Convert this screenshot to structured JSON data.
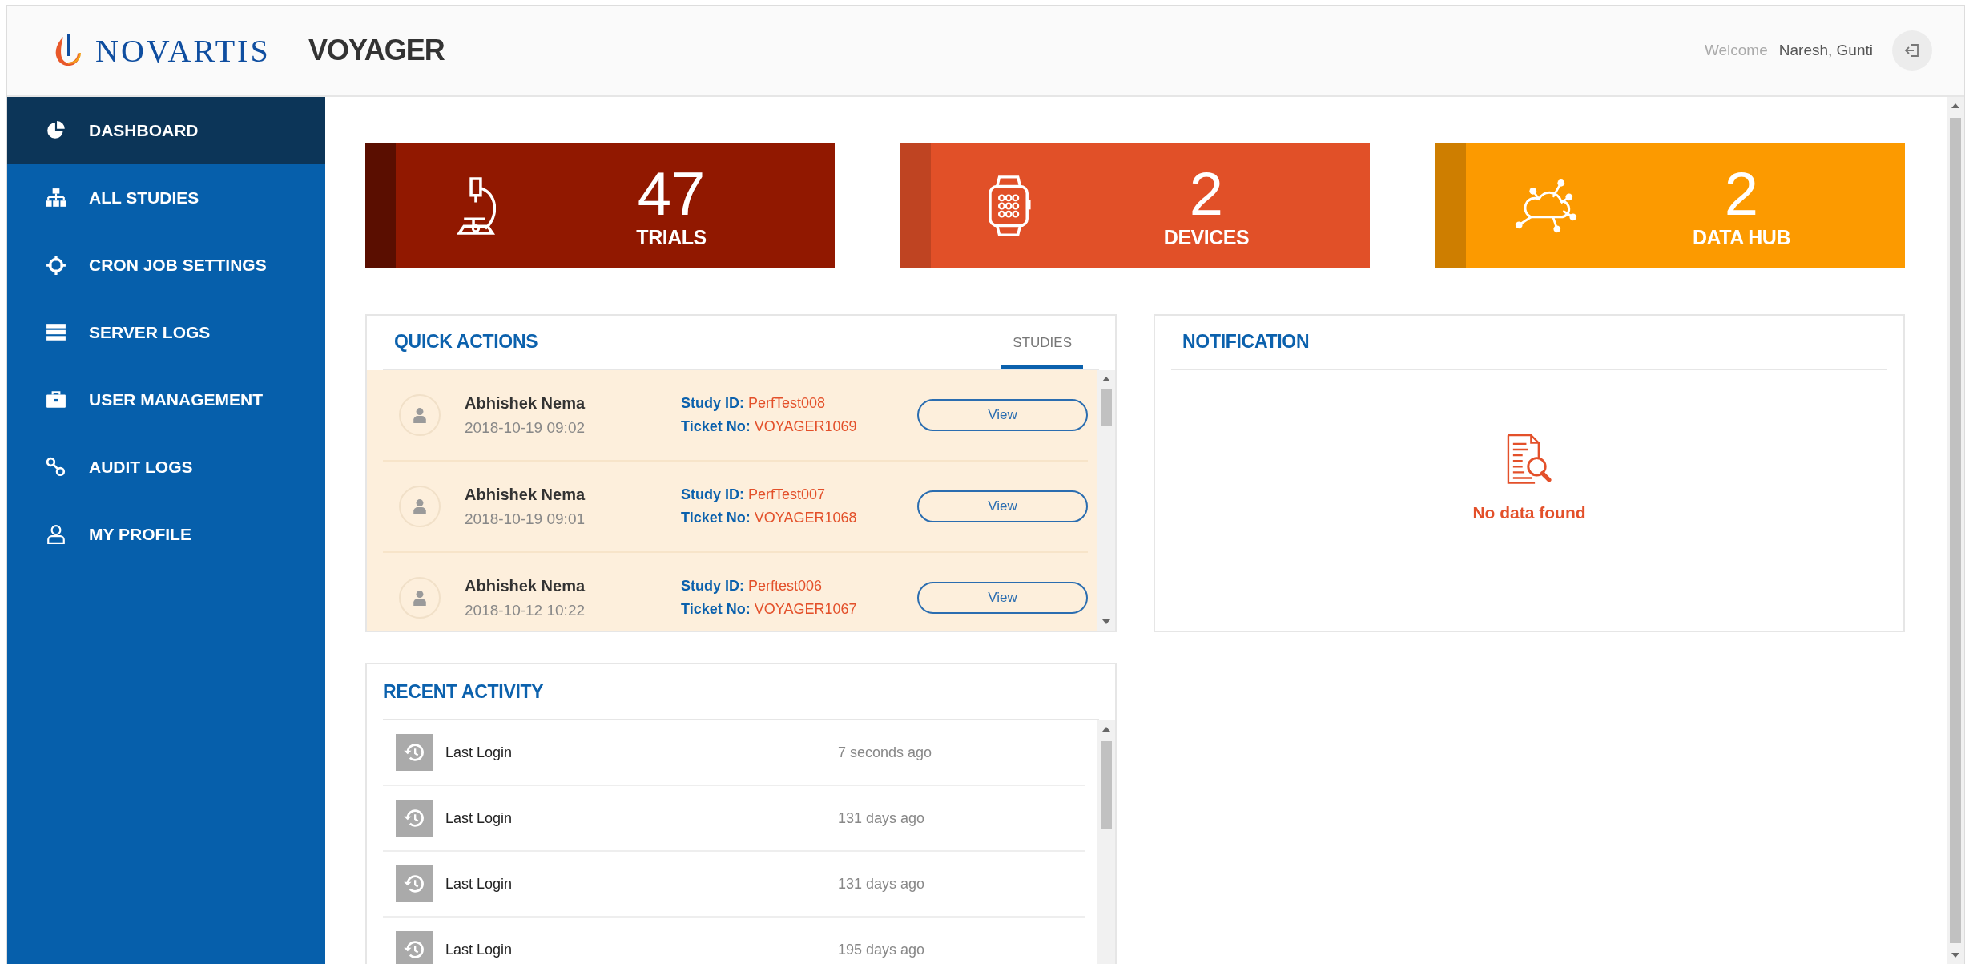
{
  "header": {
    "logo_text": "NOVARTIS",
    "app_title": "VOYAGER",
    "welcome": "Welcome",
    "user": "Naresh, Gunti"
  },
  "sidebar": {
    "items": [
      {
        "label": "DASHBOARD",
        "selected": true
      },
      {
        "label": "ALL STUDIES",
        "selected": false
      },
      {
        "label": "CRON JOB SETTINGS",
        "selected": false
      },
      {
        "label": "SERVER LOGS",
        "selected": false
      },
      {
        "label": "USER MANAGEMENT",
        "selected": false
      },
      {
        "label": "AUDIT LOGS",
        "selected": false
      },
      {
        "label": "MY PROFILE",
        "selected": false
      }
    ]
  },
  "stats": [
    {
      "value": "47",
      "label": "TRIALS",
      "color": "#911800"
    },
    {
      "value": "2",
      "label": "DEVICES",
      "color": "#e15028"
    },
    {
      "value": "2",
      "label": "DATA HUB",
      "color": "#fc9a00"
    }
  ],
  "quick_actions": {
    "title": "QUICK ACTIONS",
    "tabs": [
      {
        "label": "STUDIES",
        "selected": true
      }
    ],
    "rows": [
      {
        "name": "Abhishek Nema",
        "time": "2018-10-19 09:02",
        "study_label": "Study ID:",
        "study_id": "PerfTest008",
        "ticket_label": "Ticket No:",
        "ticket": "VOYAGER1069",
        "button": "View"
      },
      {
        "name": "Abhishek Nema",
        "time": "2018-10-19 09:01",
        "study_label": "Study ID:",
        "study_id": "PerfTest007",
        "ticket_label": "Ticket No:",
        "ticket": "VOYAGER1068",
        "button": "View"
      },
      {
        "name": "Abhishek Nema",
        "time": "2018-10-12 10:22",
        "study_label": "Study ID:",
        "study_id": "Perftest006",
        "ticket_label": "Ticket No:",
        "ticket": "VOYAGER1067",
        "button": "View"
      }
    ]
  },
  "notification": {
    "title": "NOTIFICATION",
    "empty_message": "No data found"
  },
  "recent_activity": {
    "title": "RECENT ACTIVITY",
    "items": [
      {
        "label": "Last Login",
        "time": "7 seconds ago"
      },
      {
        "label": "Last Login",
        "time": "131 days ago"
      },
      {
        "label": "Last Login",
        "time": "131 days ago"
      },
      {
        "label": "Last Login",
        "time": "195 days ago"
      }
    ]
  }
}
